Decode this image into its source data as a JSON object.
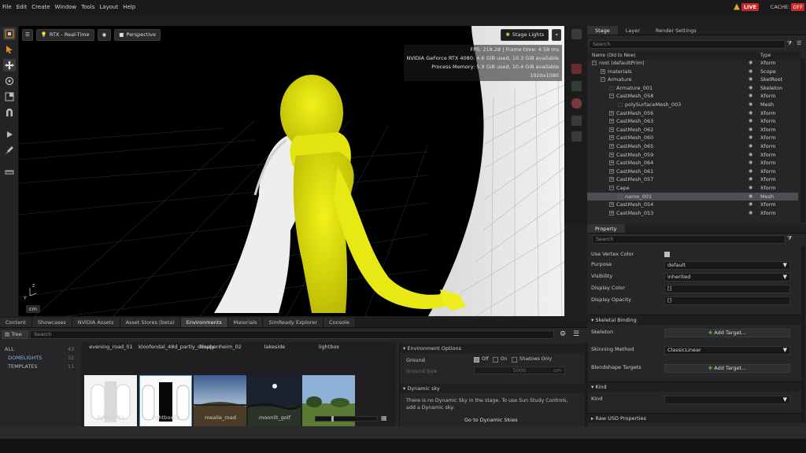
{
  "menu": [
    "File",
    "Edit",
    "Create",
    "Window",
    "Tools",
    "Layout",
    "Help"
  ],
  "status": {
    "live": "LIVE",
    "cache_label": "CACHE:",
    "cache_state": "OFF"
  },
  "viewport": {
    "render_mode": "RTX - Real-Time",
    "camera": "Perspective",
    "stage_lights": "Stage Lights",
    "stats": [
      "FPS: 218.28 | Frame time: 4.58 ms",
      "NVIDIA GeForce RTX 4080: 4.6 GiB used, 10.3 GiB available",
      "Process Memory: 5.9 GiB used, 10.4 GiB available",
      "1920x1080"
    ],
    "units": "cm",
    "axis_y": "Y",
    "axis_z": "Z"
  },
  "stage": {
    "tabs": [
      "Stage",
      "Layer",
      "Render Settings"
    ],
    "search_placeholder": "Search",
    "col_name": "Name (Old to New)",
    "col_type": "Type",
    "rows": [
      {
        "name": "root (defaultPrim)",
        "type": "Xform",
        "indent": 0,
        "exp": "−"
      },
      {
        "name": "materials",
        "type": "Scope",
        "indent": 1,
        "exp": "+"
      },
      {
        "name": "Armature",
        "type": "SkelRoot",
        "indent": 1,
        "exp": "−"
      },
      {
        "name": "Armature_001",
        "type": "Skeleton",
        "indent": 2,
        "exp": ""
      },
      {
        "name": "CastMesh_058",
        "type": "Xform",
        "indent": 2,
        "exp": "−"
      },
      {
        "name": "polySurfaceMesh_003",
        "type": "Mesh",
        "indent": 3,
        "exp": ""
      },
      {
        "name": "CastMesh_056",
        "type": "Xform",
        "indent": 2,
        "exp": "+"
      },
      {
        "name": "CastMesh_063",
        "type": "Xform",
        "indent": 2,
        "exp": "+"
      },
      {
        "name": "CastMesh_062",
        "type": "Xform",
        "indent": 2,
        "exp": "+"
      },
      {
        "name": "CastMesh_060",
        "type": "Xform",
        "indent": 2,
        "exp": "+"
      },
      {
        "name": "CastMesh_065",
        "type": "Xform",
        "indent": 2,
        "exp": "+"
      },
      {
        "name": "CastMesh_059",
        "type": "Xform",
        "indent": 2,
        "exp": "+"
      },
      {
        "name": "CastMesh_064",
        "type": "Xform",
        "indent": 2,
        "exp": "+"
      },
      {
        "name": "CastMesh_061",
        "type": "Xform",
        "indent": 2,
        "exp": "+"
      },
      {
        "name": "CastMesh_057",
        "type": "Xform",
        "indent": 2,
        "exp": "+"
      },
      {
        "name": "Cape",
        "type": "Xform",
        "indent": 2,
        "exp": "−"
      },
      {
        "name": "name_001",
        "type": "Mesh",
        "indent": 3,
        "exp": "",
        "selected": true
      },
      {
        "name": "CastMesh_054",
        "type": "Xform",
        "indent": 2,
        "exp": "+"
      },
      {
        "name": "CastMesh_053",
        "type": "Xform",
        "indent": 2,
        "exp": "+"
      }
    ]
  },
  "property": {
    "tab": "Property",
    "search_placeholder": "Search",
    "use_vertex_color": "Use Vertex Color",
    "purpose_label": "Purpose",
    "purpose_value": "default",
    "visibility_label": "Visibility",
    "visibility_value": "inherited",
    "display_color_label": "Display Color",
    "display_color_value": "[]",
    "display_opacity_label": "Display Opacity",
    "display_opacity_value": "[]",
    "skel_binding": "Skeletal Binding",
    "skeleton_label": "Skeleton",
    "add_target": "Add Target...",
    "skinning_label": "Skinning Method",
    "skinning_value": "ClassicLinear",
    "blendshape_label": "Blendshape Targets",
    "kind_section": "Kind",
    "kind_label": "Kind",
    "raw_usd": "Raw USD Properties"
  },
  "bottom": {
    "tabs": [
      "Content",
      "Showcases",
      "NVIDIA Assets",
      "Asset Stores (beta)",
      "Environments",
      "Materials",
      "SimReady Explorer",
      "Console"
    ],
    "active_tab": 4,
    "tree_label": "Tree",
    "search_placeholder": "Search",
    "categories": [
      {
        "name": "ALL",
        "count": "43"
      },
      {
        "name": "DOMELIGHTS",
        "count": "32"
      },
      {
        "name": "TEMPLATES",
        "count": "11"
      }
    ],
    "top_labels": [
      "evening_road_01",
      "kloofendal_48d_partly_cloudy",
      "kloppenheim_02",
      "lakeside",
      "lightbox"
    ],
    "thumb_labels": [
      "lightbox01",
      "lightbox02",
      "mealie_road",
      "moonlit_golf",
      ""
    ],
    "env_options": "Environment Options",
    "ground_label": "Ground",
    "off": "Off",
    "on": "On",
    "shadows_only": "Shadows Only",
    "ground_size_label": "Ground Size",
    "ground_size": "5000",
    "ground_size_unit": "cm",
    "dynamic_sky": "Dynamic sky",
    "dynamic_sky_text": "There is no Dynamic Sky in the stage. To use Sun Study Controls, add a Dynamic sky.",
    "go_dynamic": "Go to Dynamic Skies"
  }
}
